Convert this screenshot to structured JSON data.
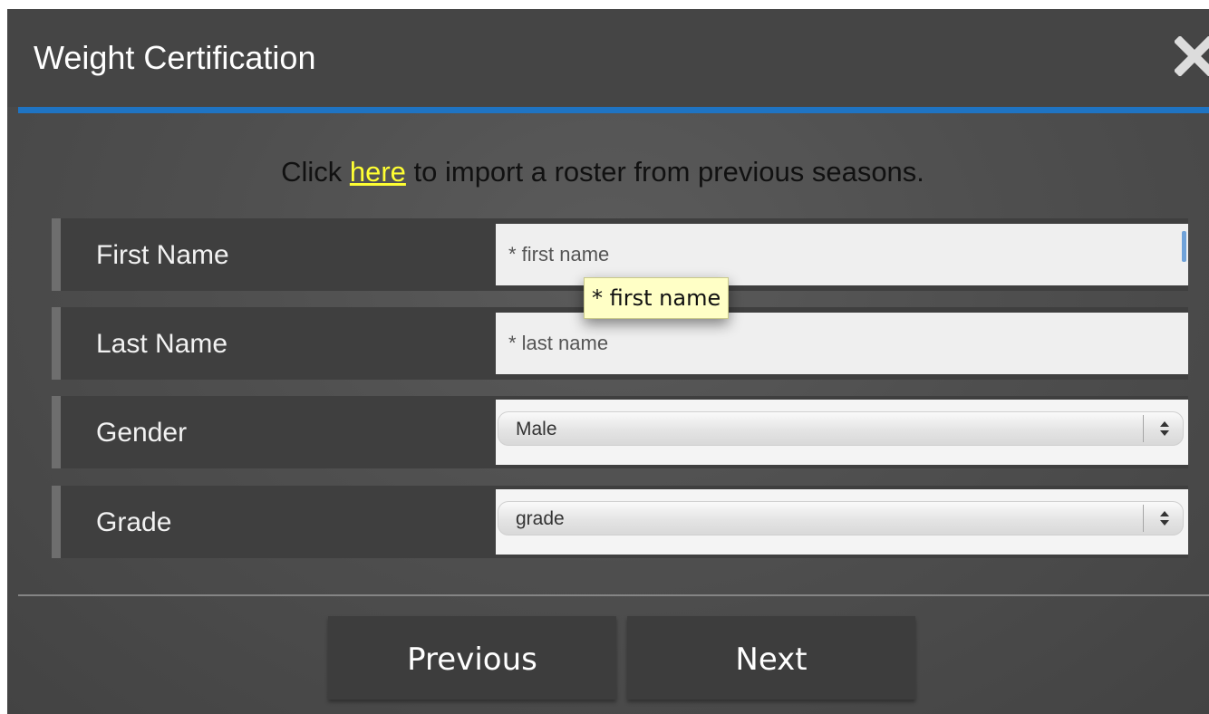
{
  "dialog": {
    "title": "Weight Certification",
    "accent_color": "#1f74c3"
  },
  "import": {
    "prefix": "Click ",
    "link_text": "here",
    "suffix": " to import a roster from previous seasons."
  },
  "form": {
    "first_name": {
      "label": "First Name",
      "placeholder": "* first name"
    },
    "last_name": {
      "label": "Last Name",
      "placeholder": "* last name"
    },
    "gender": {
      "label": "Gender",
      "value": "Male"
    },
    "grade": {
      "label": "Grade",
      "value": "grade"
    }
  },
  "tooltip": {
    "text": "* first name"
  },
  "buttons": {
    "previous": "Previous",
    "next": "Next"
  },
  "icons": {
    "close": "close-icon",
    "select_arrows": "chevron-updown-icon"
  }
}
